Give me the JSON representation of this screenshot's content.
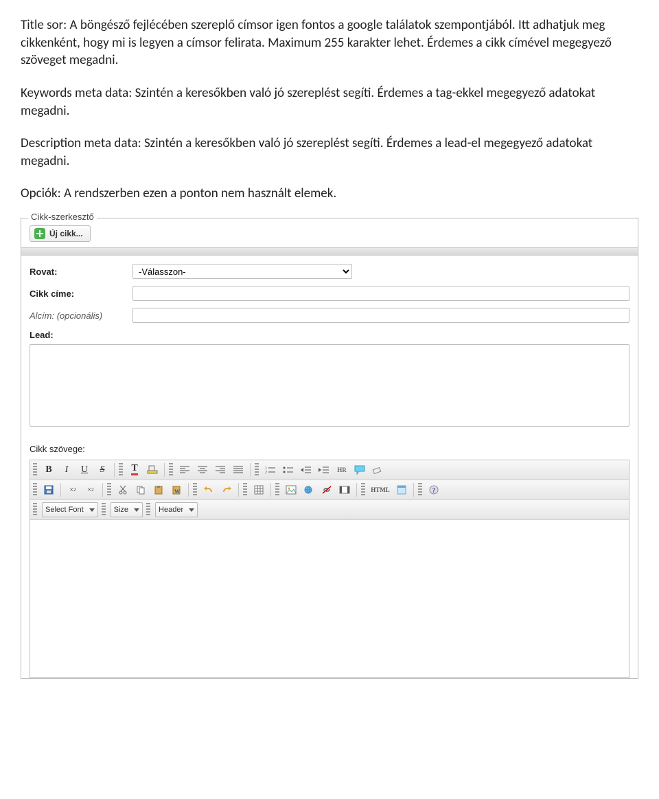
{
  "doc": {
    "p1": "Title sor: A böngésző fejlécében szereplő címsor igen fontos a google találatok szempontjából. Itt adhatjuk meg cikkenként, hogy mi is legyen a címsor felirata. Maximum 255 karakter lehet. Érdemes a cikk címével megegyező szöveget megadni.",
    "p2": "Keywords meta data: Szintén a keresőkben való jó szereplést segíti. Érdemes a tag-ekkel megegyező adatokat megadni.",
    "p3": "Description meta data: Szintén a keresőkben való jó szereplést segíti. Érdemes a lead-el megegyező adatokat megadni.",
    "p4": "Opciók: A rendszerben ezen a ponton nem használt elemek."
  },
  "editor": {
    "legend": "Cikk-szerkesztő",
    "new_button": "Új cikk...",
    "labels": {
      "rovat": "Rovat:",
      "cim": "Cikk címe:",
      "alcim": "Alcím: (opcionális)",
      "lead": "Lead:",
      "body": "Cikk szövege:"
    },
    "rovat_selected": "-Válasszon-",
    "toolbar": {
      "row1": {
        "bold": "B",
        "italic": "I",
        "underline": "U",
        "strike": "S",
        "textcolor": "T",
        "hr": "HR"
      },
      "row2": {
        "html": "HTML"
      },
      "row3": {
        "font": "Select Font",
        "size": "Size",
        "header": "Header"
      }
    }
  }
}
